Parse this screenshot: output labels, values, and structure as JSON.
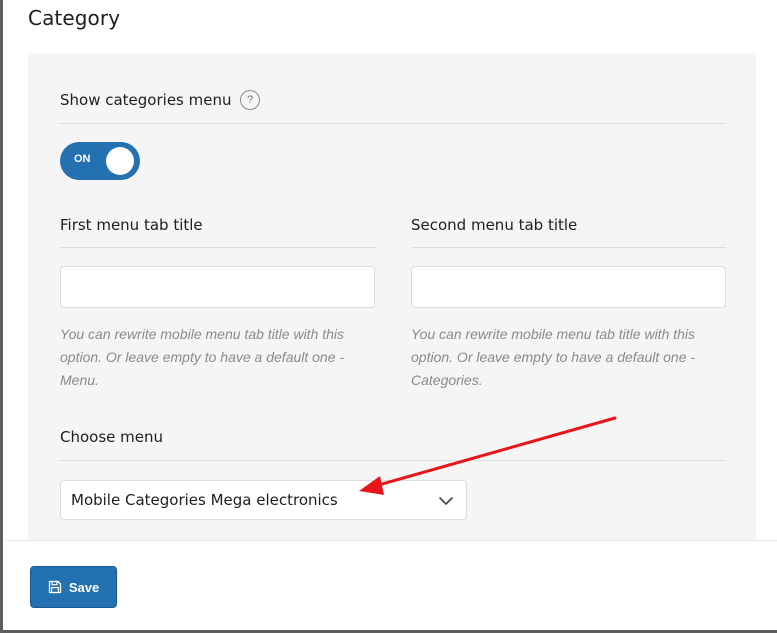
{
  "header": {
    "title": "Category"
  },
  "show_menu": {
    "label": "Show categories menu",
    "help": "?",
    "toggle_state": "ON"
  },
  "first_tab": {
    "label": "First menu tab title",
    "value": "",
    "hint": "You can rewrite mobile menu tab title with this option. Or leave empty to have a default one - Menu."
  },
  "second_tab": {
    "label": "Second menu tab title",
    "value": "",
    "hint": "You can rewrite mobile menu tab title with this option. Or leave empty to have a default one - Categories."
  },
  "choose_menu": {
    "label": "Choose menu",
    "selected": "Mobile Categories Mega electronics"
  },
  "footer": {
    "save_label": "Save"
  },
  "colors": {
    "accent": "#2371b1",
    "annotation_arrow": "#e8141b"
  },
  "icons": {
    "help": "question-circle-icon",
    "dropdown": "chevron-down-icon",
    "save": "floppy-disk-icon"
  }
}
